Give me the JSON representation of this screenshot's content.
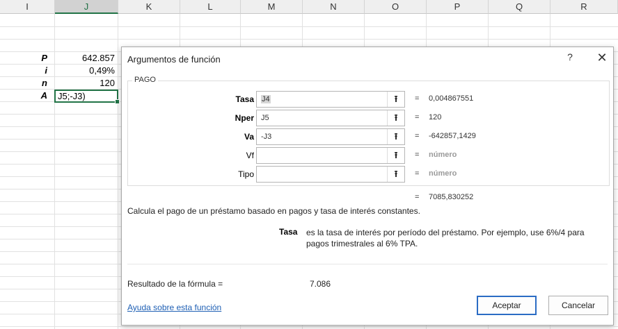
{
  "columns": [
    "I",
    "J",
    "K",
    "L",
    "M",
    "N",
    "O",
    "P",
    "Q",
    "R"
  ],
  "selected_column": "J",
  "cells": [
    {
      "label": "P",
      "value": "642.857"
    },
    {
      "label": "i",
      "value": "0,49%"
    },
    {
      "label": "n",
      "value": "120"
    },
    {
      "label": "A",
      "value": ""
    }
  ],
  "active_cell_text": "J5;-J3)",
  "dialog": {
    "title": "Argumentos de función",
    "help_glyph": "?",
    "close_glyph": "✕",
    "group_label": "PAGO",
    "args": [
      {
        "name": "Tasa",
        "input": "J4",
        "result": "0,004867551",
        "bold": true
      },
      {
        "name": "Nper",
        "input": "J5",
        "result": "120",
        "bold": true
      },
      {
        "name": "Va",
        "input": "-J3",
        "result": "-642857,1429",
        "bold": true
      },
      {
        "name": "Vf",
        "input": "",
        "result": "número",
        "bold": false
      },
      {
        "name": "Tipo",
        "input": "",
        "result": "número",
        "bold": false
      }
    ],
    "equals": "=",
    "picker_glyph": "⭱",
    "final_result": "7085,830252",
    "description": "Calcula el pago de un préstamo basado en pagos y tasa de interés constantes.",
    "arg_desc_name": "Tasa",
    "arg_desc_text": "es la tasa de interés por período del préstamo. Por ejemplo, use 6%/4 para pagos trimestrales al 6% TPA.",
    "formula_result_label": "Resultado de la fórmula =",
    "formula_result_value": "7.086",
    "help_link": "Ayuda sobre esta función",
    "ok_label": "Aceptar",
    "cancel_label": "Cancelar"
  }
}
